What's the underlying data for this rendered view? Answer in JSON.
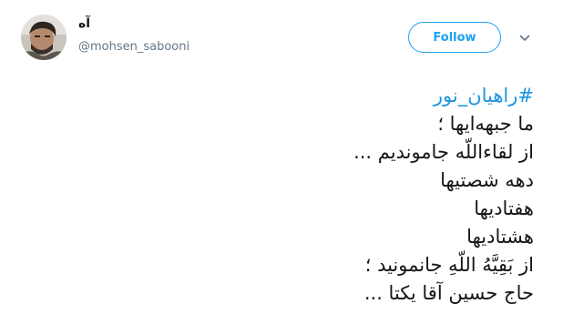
{
  "author": {
    "display_name": "آه",
    "handle": "@mohsen_sabooni"
  },
  "follow_button": {
    "label": "Follow"
  },
  "icons": {
    "avatar": "avatar",
    "menu": "chevron-down-icon"
  },
  "colors": {
    "accent": "#1da1f2",
    "hashtag": "#1b95e0",
    "text": "#14171a",
    "secondary_text": "#657786"
  },
  "tweet": {
    "hashtag": "#راهیان_نور",
    "lines": [
      "ما جبهه‌ایها ؛",
      "از لقاءاللّه جاموندیم ...",
      "دهه شصتیها",
      "هفتادیها",
      "هشتادیها",
      "از بَقِیَّهُ اللّهِ جانمونید ؛",
      "حاج حسین آقا یکتا ..."
    ]
  }
}
